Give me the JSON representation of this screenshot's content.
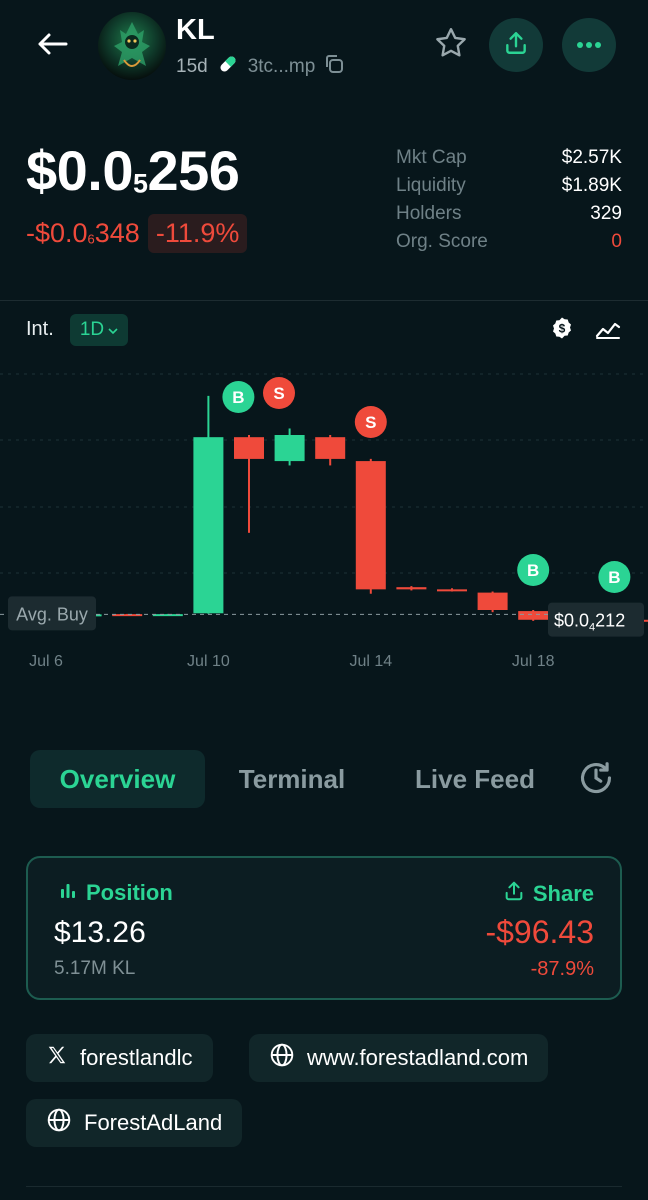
{
  "header": {
    "title": "KL",
    "age": "15d",
    "address": "3tc...mp",
    "icons": {
      "back": "arrow-left-icon",
      "pill": "pill-icon",
      "copy": "copy-icon",
      "star": "star-icon",
      "share": "upload-icon",
      "more": "more-icon"
    }
  },
  "price": {
    "lead": "$0.0",
    "zeros": "5",
    "digits": "256"
  },
  "change": {
    "lead": "-$0.0",
    "zeros": "6",
    "digits": "348",
    "percent": "-11.9%"
  },
  "stats": [
    {
      "label": "Mkt Cap",
      "value": "$2.57K"
    },
    {
      "label": "Liquidity",
      "value": "$1.89K"
    },
    {
      "label": "Holders",
      "value": "329"
    },
    {
      "label": "Org. Score",
      "value": "0"
    }
  ],
  "chart_controls": {
    "interval_label": "Int.",
    "interval_value": "1D"
  },
  "chart_data": {
    "type": "candlestick",
    "x_ticks": [
      "Jul 6",
      "Jul 10",
      "Jul 14",
      "Jul 18"
    ],
    "avg_buy_label": "Avg. Buy",
    "last_price": {
      "lead": "$0.0",
      "zeros": "4",
      "digits": "212"
    },
    "candles": [
      {
        "o": 4.35,
        "c": 4.38,
        "h": 4.4,
        "l": 4.33
      },
      {
        "o": 4.4,
        "c": 4.45,
        "h": 4.48,
        "l": 4.37
      },
      {
        "o": 4.46,
        "c": 4.44,
        "h": 4.47,
        "l": 4.43
      },
      {
        "o": 4.45,
        "c": 4.46,
        "h": 4.47,
        "l": 4.44
      },
      {
        "o": 4.5,
        "c": 12.6,
        "h": 14.5,
        "l": 4.48
      },
      {
        "o": 12.6,
        "c": 11.6,
        "h": 12.7,
        "l": 8.2
      },
      {
        "o": 11.5,
        "c": 12.7,
        "h": 13.0,
        "l": 11.3
      },
      {
        "o": 12.6,
        "c": 11.6,
        "h": 12.7,
        "l": 11.3
      },
      {
        "o": 11.5,
        "c": 5.6,
        "h": 11.6,
        "l": 5.4
      },
      {
        "o": 5.7,
        "c": 5.6,
        "h": 5.75,
        "l": 5.55
      },
      {
        "o": 5.6,
        "c": 5.55,
        "h": 5.65,
        "l": 5.5
      },
      {
        "o": 5.45,
        "c": 4.65,
        "h": 5.5,
        "l": 4.55
      },
      {
        "o": 4.6,
        "c": 4.2,
        "h": 4.65,
        "l": 4.15
      },
      {
        "o": 4.22,
        "c": 4.24,
        "h": 4.26,
        "l": 4.2
      },
      {
        "o": 4.23,
        "c": 4.21,
        "h": 4.25,
        "l": 4.2
      },
      {
        "o": 4.2,
        "c": 4.18,
        "h": 4.22,
        "l": 4.15
      }
    ],
    "markers": [
      {
        "type": "B",
        "candle": 4
      },
      {
        "type": "S",
        "candle": 5
      },
      {
        "type": "S",
        "candle": 8
      },
      {
        "type": "B",
        "candle": 12
      },
      {
        "type": "B",
        "candle": 14
      }
    ],
    "avg_buy": 4.45,
    "colors": {
      "up": "#2bd494",
      "down": "#ef4a3b",
      "grid": "#1d3237"
    }
  },
  "tabs": [
    {
      "label": "Overview",
      "active": true
    },
    {
      "label": "Terminal",
      "active": false
    },
    {
      "label": "Live Feed",
      "active": false
    }
  ],
  "position": {
    "label": "Position",
    "share": "Share",
    "value": "$13.26",
    "amount": "5.17M KL",
    "pnl": "-$96.43",
    "pnl_pct": "-87.9%"
  },
  "links": [
    {
      "icon": "x-logo-icon",
      "label": "forestlandlc"
    },
    {
      "icon": "globe-icon",
      "label": "www.forestadland.com"
    },
    {
      "icon": "globe-icon",
      "label": "ForestAdLand"
    }
  ],
  "colors": {
    "accent": "#2bd494",
    "negative": "#ef4a3b",
    "background": "#07161b"
  }
}
